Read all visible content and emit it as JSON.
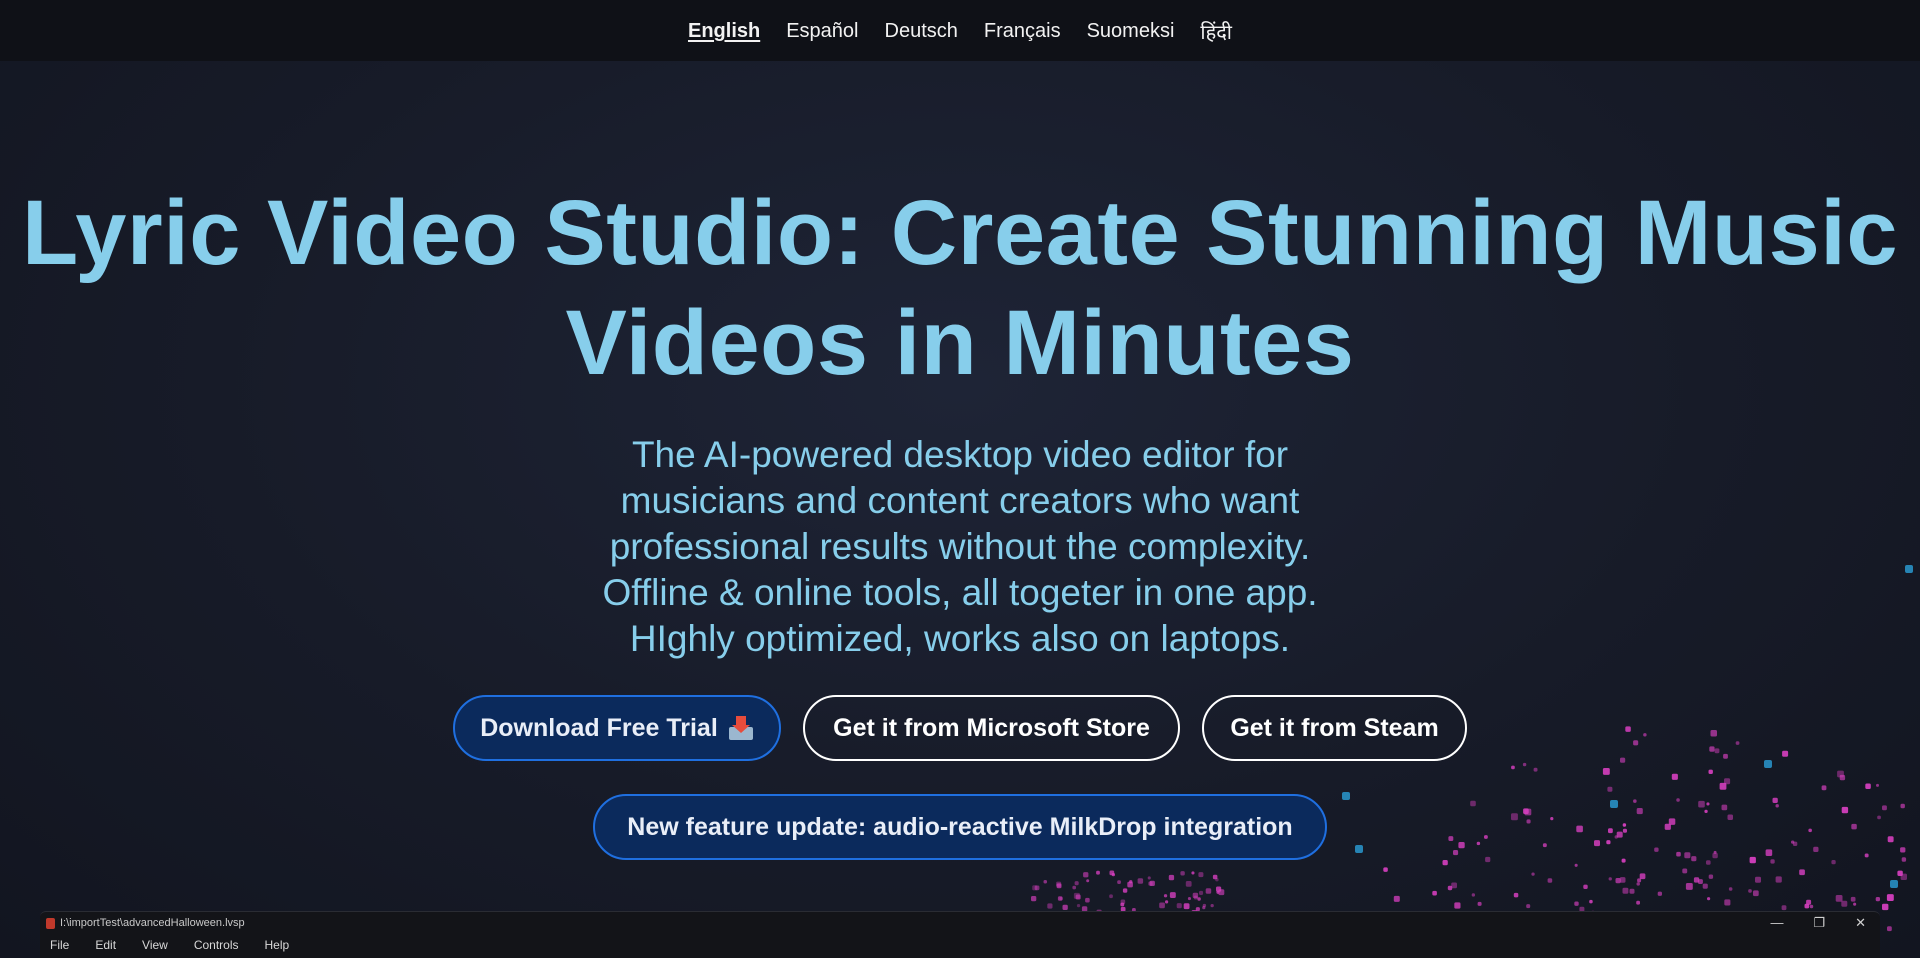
{
  "nav": {
    "languages": [
      {
        "label": "English",
        "active": true
      },
      {
        "label": "Español",
        "active": false
      },
      {
        "label": "Deutsch",
        "active": false
      },
      {
        "label": "Français",
        "active": false
      },
      {
        "label": "Suomeksi",
        "active": false
      },
      {
        "label": "हिंदी",
        "active": false
      }
    ]
  },
  "hero": {
    "title_line1": "Lyric Video Studio: Create Stunning Music",
    "title_line2": "Videos in Minutes",
    "subtitle_lines": [
      "The AI-powered desktop video editor for",
      "musicians and content creators who want",
      "professional results without the complexity.",
      "Offline & online tools, all togeter in one app.",
      "HIghly optimized, works also on laptops."
    ]
  },
  "buttons": {
    "download": "Download Free Trial",
    "download_icon": "inbox-tray-icon",
    "microsoft": "Get it from Microsoft Store",
    "steam": "Get it from Steam",
    "feature": "New feature update: audio-reactive MilkDrop integration"
  },
  "app_preview": {
    "path": "I:\\importTest\\advancedHalloween.lvsp",
    "menu": [
      "File",
      "Edit",
      "View",
      "Controls",
      "Help"
    ],
    "window_controls": [
      "—",
      "❐",
      "✕"
    ]
  },
  "colors": {
    "accent": "#87ceeb",
    "primary_button_bg": "#0b2a5c",
    "primary_button_border": "#1f6fe0",
    "particles": "#d63fbf"
  }
}
